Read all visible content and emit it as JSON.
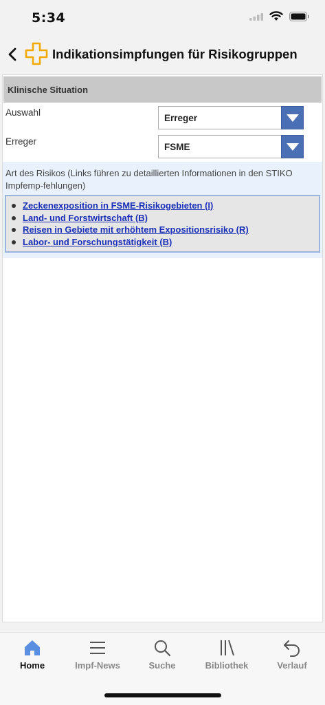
{
  "status": {
    "time": "5:34"
  },
  "nav": {
    "title": "Indikationsimpfungen für Risikogruppen"
  },
  "section": {
    "heading": "Klinische Situation"
  },
  "form": {
    "auswahl_label": "Auswahl",
    "auswahl_value": "Erreger",
    "erreger_label": "Erreger",
    "erreger_value": "FSME"
  },
  "risk": {
    "title": "Art des Risikos (Links führen zu detaillierten Informationen in den STIKO Impfemp-fehlungen)",
    "items": [
      "Zeckenexposition in FSME-Risikogebieten (I)",
      "Land- und Forstwirtschaft (B)",
      "Reisen in Gebiete mit erhöhtem Expositionsrisiko (R)",
      "Labor- und Forschungstätigkeit (B)"
    ]
  },
  "tabs": [
    {
      "label": "Home",
      "icon": "home-icon",
      "active": true
    },
    {
      "label": "Impf-News",
      "icon": "menu-lines-icon",
      "active": false
    },
    {
      "label": "Suche",
      "icon": "search-icon",
      "active": false
    },
    {
      "label": "Bibliothek",
      "icon": "library-icon",
      "active": false
    },
    {
      "label": "Verlauf",
      "icon": "undo-arrow-icon",
      "active": false
    }
  ],
  "colors": {
    "accent": "#f2a900",
    "select_button": "#4a6fb5",
    "link": "#1a2fb8",
    "tab_active": "#5a8ee0"
  }
}
